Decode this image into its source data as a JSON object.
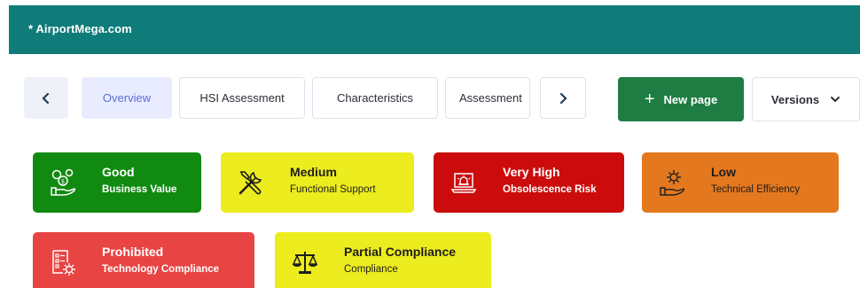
{
  "header": {
    "brand": "* AirportMega.com"
  },
  "tabs": {
    "prev_icon": "chevron-left-icon",
    "next_icon": "chevron-right-icon",
    "items": [
      {
        "label": "Overview"
      },
      {
        "label": "HSI Assessment"
      },
      {
        "label": "Characteristics"
      },
      {
        "label": "Assessment"
      }
    ],
    "active": "Overview"
  },
  "toolbar": {
    "new_page_label": "New page",
    "versions_label": "Versions"
  },
  "cards": [
    {
      "title": "Good",
      "subtitle": "Business Value",
      "icon": "money-hand-icon",
      "color": "#118a11"
    },
    {
      "title": "Medium",
      "subtitle": "Functional Support",
      "icon": "tools-icon",
      "color": "#ecec1e"
    },
    {
      "title": "Very High",
      "subtitle": "Obsolescence Risk",
      "icon": "alert-laptop-icon",
      "color": "#cc0c0c"
    },
    {
      "title": "Low",
      "subtitle": "Technical Efficiency",
      "icon": "gear-hand-icon",
      "color": "#e4781e"
    },
    {
      "title": "Prohibited",
      "subtitle": "Technology Compliance",
      "icon": "document-gear-icon",
      "color": "#e94444"
    },
    {
      "title": "Partial Compliance",
      "subtitle": "Compliance",
      "icon": "scales-icon",
      "color": "#ecec1e"
    }
  ]
}
